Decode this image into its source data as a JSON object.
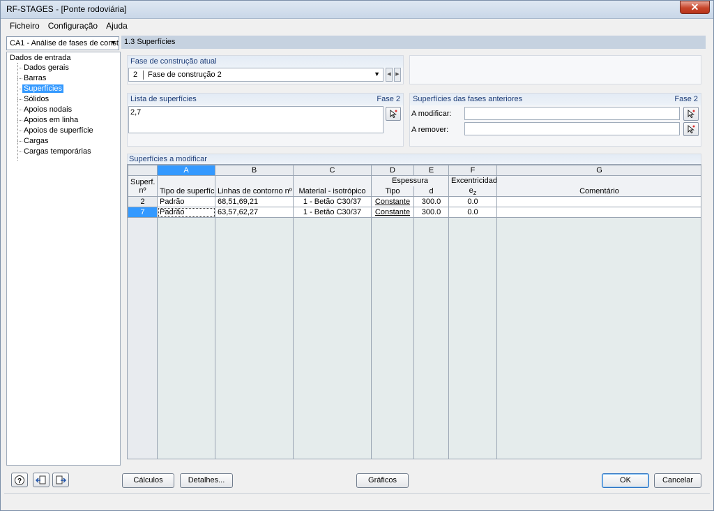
{
  "window": {
    "title": "RF-STAGES - [Ponte rodoviária]",
    "close_label": "✕"
  },
  "menu": [
    "Ficheiro",
    "Configuração",
    "Ajuda"
  ],
  "case_selector": {
    "value": "CA1 - Análise de fases de const"
  },
  "tree": {
    "root": "Dados de entrada",
    "items": [
      "Dados gerais",
      "Barras",
      "Superfícies",
      "Sólidos",
      "Apoios nodais",
      "Apoios em linha",
      "Apoios de superfície",
      "Cargas",
      "Cargas temporárias"
    ],
    "selected_index": 2
  },
  "section_title": "1.3 Superfícies",
  "current_stage": {
    "label": "Fase de construção atual",
    "number": "2",
    "name": "Fase de construção 2"
  },
  "surface_list": {
    "label": "Lista de superfícies",
    "stage": "Fase 2",
    "value": "2,7"
  },
  "previous_stages": {
    "label": "Superfícies das fases anteriores",
    "stage": "Fase 2",
    "modify_label": "A modificar:",
    "remove_label": "A remover:",
    "modify_value": "",
    "remove_value": ""
  },
  "modify_table": {
    "label": "Superfícies a modificar",
    "col_letters": [
      "A",
      "B",
      "C",
      "D",
      "E",
      "F",
      "G"
    ],
    "header_row1": {
      "superf": "Superf.",
      "espessura": "Espessura",
      "excentricidade": "Excentricidade"
    },
    "header_row2": {
      "no": "nº",
      "tipo_superficie": "Tipo de superfície",
      "linhas_contorno": "Linhas de contorno nº",
      "material": "Material - isotrópico",
      "tipo": "Tipo",
      "d": "d",
      "ez": "e",
      "ez_sub": "z",
      "comentario": "Comentário"
    },
    "rows": [
      {
        "no": "2",
        "tipo_superficie": "Padrão",
        "linhas": "68,51,69,21",
        "material": "1 - Betão C30/37",
        "tipo": "Constante",
        "d": "300.0",
        "ez": "0.0",
        "comentario": ""
      },
      {
        "no": "7",
        "tipo_superficie": "Padrão",
        "linhas": "63,57,62,27",
        "material": "1 - Betão C30/37",
        "tipo": "Constante",
        "d": "300.0",
        "ez": "0.0",
        "comentario": ""
      }
    ]
  },
  "buttons": {
    "calculos": "Cálculos",
    "detalhes": "Detalhes...",
    "graficos": "Gráficos",
    "ok": "OK",
    "cancelar": "Cancelar"
  },
  "colors": {
    "selection": "#3399ff",
    "title_bar": "#c6d2e0",
    "group_heading_text": "#1d3d78"
  }
}
